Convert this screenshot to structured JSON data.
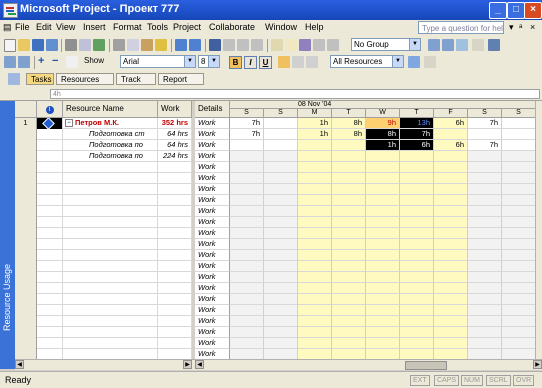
{
  "window": {
    "title": "Microsoft Project - Проект 777"
  },
  "menu": {
    "items": [
      "File",
      "Edit",
      "View",
      "Insert",
      "Format",
      "Tools",
      "Project",
      "Collaborate",
      "Window",
      "Help"
    ],
    "help_placeholder": "Type a question for help"
  },
  "toolbar_standard": {
    "group_value": "No Group"
  },
  "toolbar_formatting": {
    "show_label": "Show",
    "font_value": "Arial",
    "size_value": "8",
    "bold": "B",
    "italic": "I",
    "underline": "U",
    "filter_value": "All Resources"
  },
  "toolbar_guide": {
    "tasks": "Tasks",
    "resources": "Resources",
    "track": "Track",
    "report": "Report"
  },
  "entry_bar": {
    "value": "4h"
  },
  "view_bar": {
    "label": "Resource Usage"
  },
  "grid": {
    "headers": {
      "indicator": "i",
      "name": "Resource Name",
      "work": "Work"
    },
    "rows": [
      {
        "id": "1",
        "name": "Петров М.К.",
        "work": "352 hrs"
      },
      {
        "id": "",
        "name": "Подготовка ст",
        "work": "64 hrs"
      },
      {
        "id": "",
        "name": "Подготовка по",
        "work": "64 hrs"
      },
      {
        "id": "",
        "name": "Подготовка по",
        "work": "224 hrs"
      }
    ]
  },
  "details": {
    "header": "Details",
    "row_label": "Work"
  },
  "timescale": {
    "week_label": "08 Nov '04",
    "days": [
      "S",
      "S",
      "M",
      "T",
      "W",
      "T",
      "F",
      "S",
      "S"
    ],
    "rows": [
      [
        "7h",
        "",
        "1h",
        "8h",
        "9h",
        "13h",
        "6h",
        "7h",
        ""
      ],
      [
        "7h",
        "",
        "1h",
        "8h",
        "8h",
        "7h",
        "",
        "",
        ""
      ],
      [
        "",
        "",
        "",
        "",
        "1h",
        "6h",
        "6h",
        "7h",
        ""
      ]
    ]
  },
  "status": {
    "text": "Ready",
    "indicators": [
      "EXT",
      "CAPS",
      "NUM",
      "SCRL",
      "OVR"
    ]
  },
  "colors": {
    "titlebar": "#1646b8",
    "viewbar": "#3a72d8",
    "highlight": "#fffbc0",
    "selected": "#000000",
    "accent_red": "#c00000"
  }
}
